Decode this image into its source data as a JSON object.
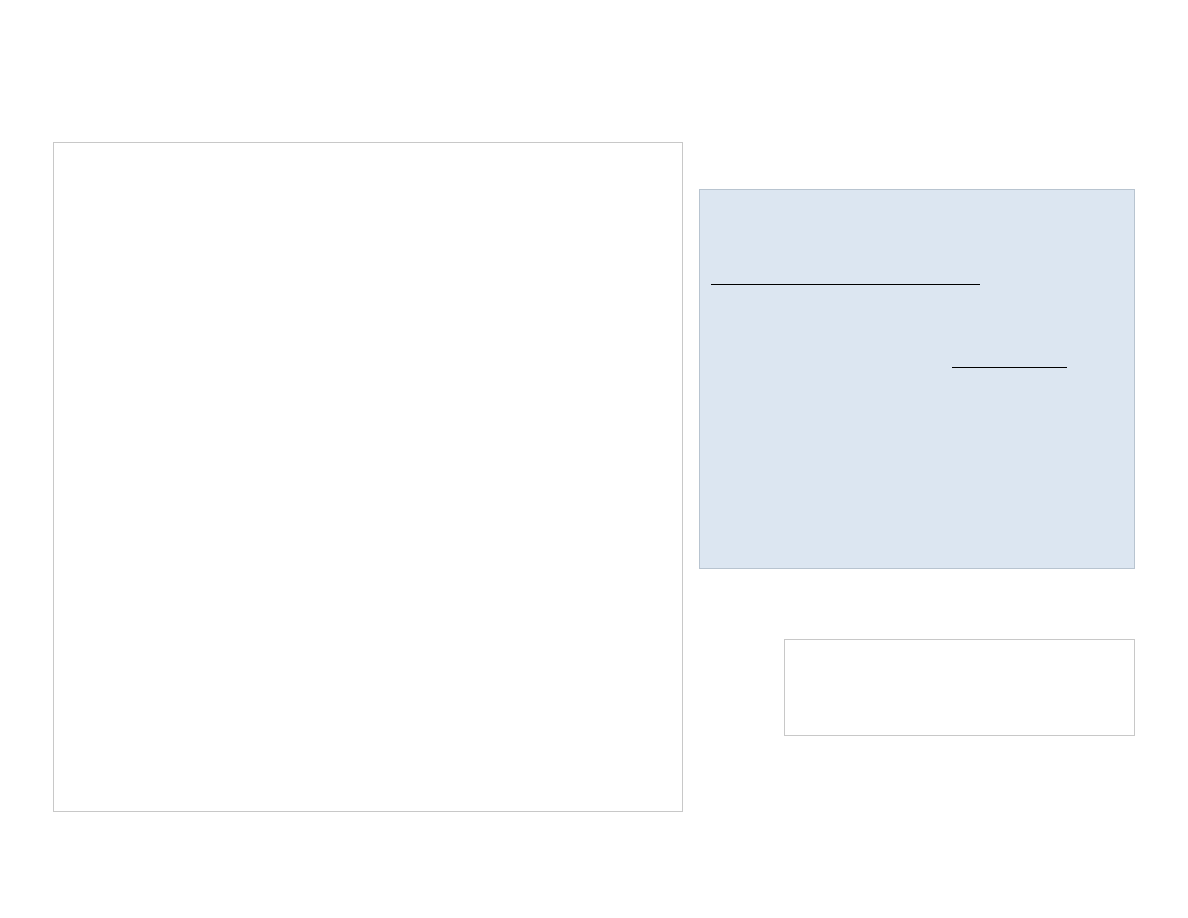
{
  "colors": {
    "page_background": "#ffffff",
    "info_panel_background": "#dce6f1",
    "panel_border": "#c8c8c8",
    "line_color": "#000000"
  }
}
